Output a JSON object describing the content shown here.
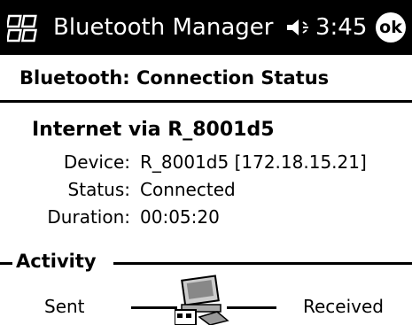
{
  "titlebar": {
    "app_title": "Bluetooth Manager",
    "clock": "3:45",
    "ok_label": "ok"
  },
  "header": {
    "title": "Bluetooth: Connection Status"
  },
  "connection": {
    "name": "Internet via R_8001d5",
    "details": [
      {
        "label": "Device:",
        "value": "R_8001d5 [172.18.15.21]"
      },
      {
        "label": "Status:",
        "value": "Connected"
      },
      {
        "label": "Duration:",
        "value": "00:05:20"
      }
    ]
  },
  "activity": {
    "title": "Activity",
    "sent_label": "Sent",
    "received_label": "Received"
  },
  "icons": {
    "start": "windows-flag-icon",
    "volume": "speaker-icon",
    "device": "computer-icon"
  },
  "colors": {
    "titlebar_bg": "#000000",
    "background": "#ffffff"
  }
}
